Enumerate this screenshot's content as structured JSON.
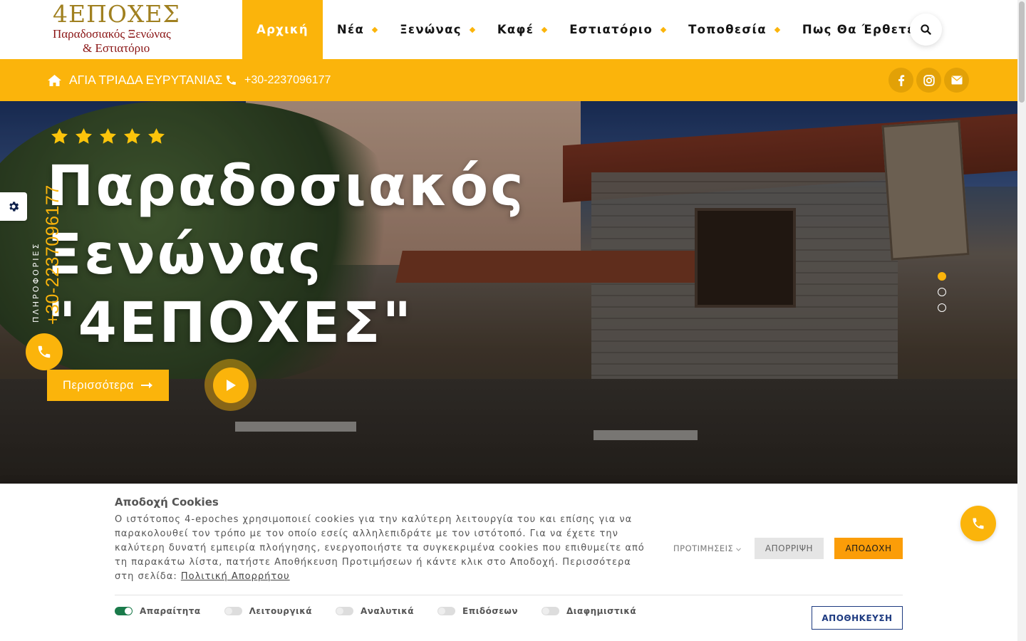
{
  "logo": {
    "title": "4ΕΠΟΧΕΣ",
    "subtitle_line1": "Παραδοσιακός Ξενώνας",
    "subtitle_line2": "& Εστιατόριο"
  },
  "nav": {
    "items": [
      {
        "label": "Αρχική",
        "active": true
      },
      {
        "label": "Νέα"
      },
      {
        "label": "Ξενώνας"
      },
      {
        "label": "Καφέ"
      },
      {
        "label": "Εστιατόριο"
      },
      {
        "label": "Τοποθεσία"
      },
      {
        "label": "Πως Θα Έρθετε"
      }
    ],
    "search_icon": "search-icon"
  },
  "topbar": {
    "address": "ΑΓΙΑ ΤΡΙΑΔΑ ΕΥΡΥΤΑΝΙΑΣ",
    "phone": "+30-2237096177",
    "social": [
      "facebook-icon",
      "instagram-icon",
      "envelope-icon"
    ]
  },
  "hero": {
    "stars": 5,
    "title_line1": "Παραδοσιακός",
    "title_line2": "Ξενώνας",
    "title_line3": "\"4ΕΠΟΧΕΣ\"",
    "more_button": "Περισσότερα",
    "slides_total": 3,
    "slide_active": 1
  },
  "side": {
    "info_label": "ΠΛΗΡΟΦΟΡΙΕΣ",
    "phone": "+30-2237096177"
  },
  "cookie": {
    "title": "Αποδοχή Cookies",
    "text": "Ο ιστότοπος 4-epoches χρησιμοποιεί cookies για την καλύτερη λειτουργία του και επίσης για να παρακολουθεί τον τρόπο με τον οποίο εσείς αλληλεπιδράτε με τον ιστότοπό. Για να έχετε την καλύτερη δυνατή εμπειρία πλοήγησης, ενεργοποιήστε τα συγκεκριμένα cookies που επιθυμείτε από τη παρακάτω λίστα, πατήστε Αποθήκευση Προτιμήσεων ή κάντε κλικ στο Αποδοχή. Περισσότερα στη σελίδα:",
    "policy_link": "Πολιτική Απορρήτου",
    "preferences": "ΠΡΟΤΙΜΗΣΕΙΣ",
    "reject": "ΑΠΟΡΡΙΨΗ",
    "accept": "ΑΠΟΔΟΧΗ",
    "toggles": [
      {
        "label": "Απαραίτητα",
        "on": true
      },
      {
        "label": "Λειτουργικά",
        "on": false
      },
      {
        "label": "Αναλυτικά",
        "on": false
      },
      {
        "label": "Επιδόσεων",
        "on": false
      },
      {
        "label": "Διαφημιστικά",
        "on": false
      }
    ],
    "save": "ΑΠΟΘΗΚΕΥΣΗ"
  },
  "colors": {
    "accent": "#fbb40b",
    "accept_button": "#fb9d08",
    "save_border": "#1d3a80",
    "toggle_on": "#1a7a4a"
  }
}
